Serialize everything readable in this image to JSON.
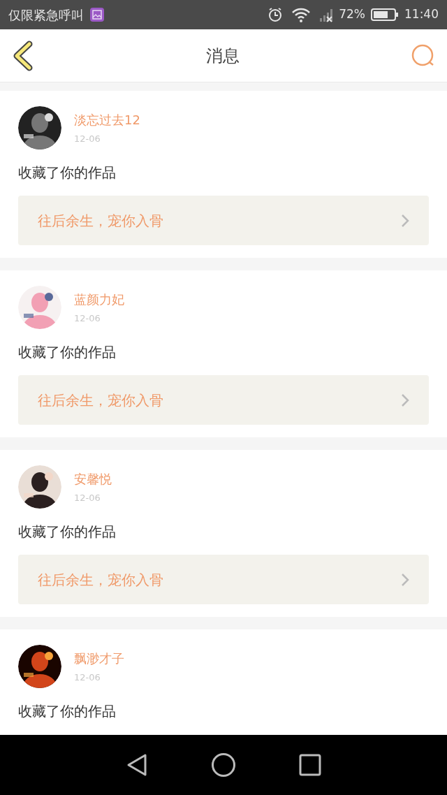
{
  "status_bar": {
    "carrier": "仅限紧急呼叫",
    "battery": "72%",
    "time": "11:40"
  },
  "header": {
    "title": "消息"
  },
  "messages": [
    {
      "name": "淡忘过去12",
      "date": "12-06",
      "action": "收藏了你的作品",
      "work": "往后余生，宠你入骨"
    },
    {
      "name": "蓝颜力妃",
      "date": "12-06",
      "action": "收藏了你的作品",
      "work": "往后余生，宠你入骨"
    },
    {
      "name": "安馨悦",
      "date": "12-06",
      "action": "收藏了你的作品",
      "work": "往后余生，宠你入骨"
    },
    {
      "name": "飘渺才子",
      "date": "12-06",
      "action": "收藏了你的作品"
    }
  ]
}
